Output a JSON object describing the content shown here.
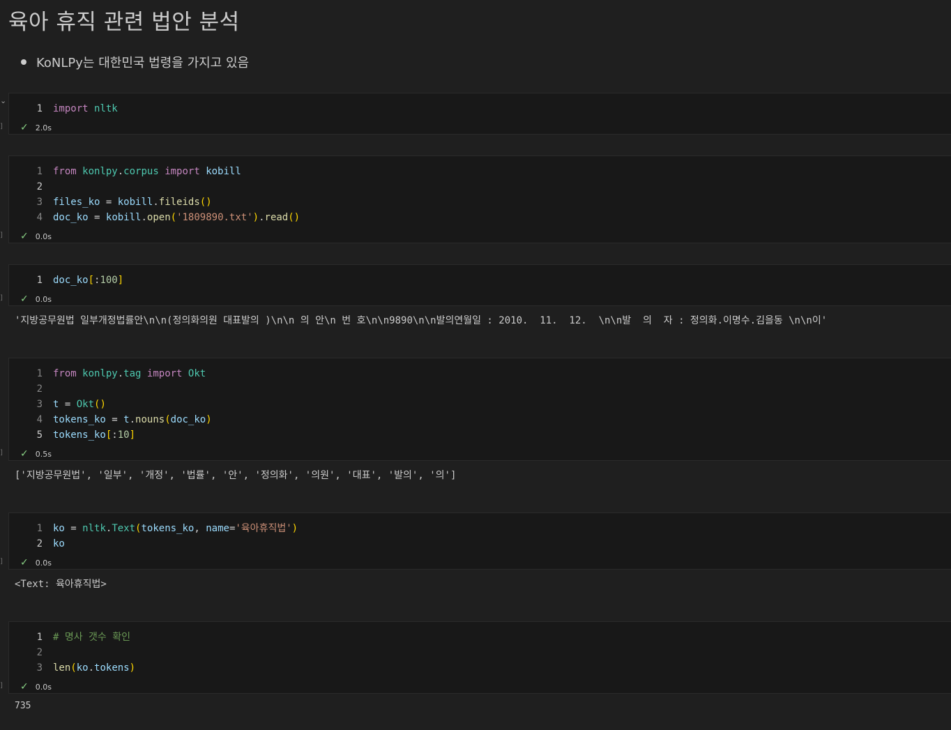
{
  "markdown": {
    "title": "육아 휴직 관련 법안 분석",
    "bullets": [
      "KoNLPy는 대한민국 법령을 가지고 있음"
    ]
  },
  "cells": [
    {
      "exec_time": "2.0s",
      "lines": [
        "import nltk"
      ]
    },
    {
      "exec_time": "0.0s",
      "lines": [
        "from konlpy.corpus import kobill",
        "",
        "files_ko = kobill.fileids()",
        "doc_ko = kobill.open('1809890.txt').read()"
      ]
    },
    {
      "exec_time": "0.0s",
      "lines": [
        "doc_ko[:100]"
      ],
      "output": "'지방공무원법 일부개정법률안\\n\\n(정의화의원 대표발의 )\\n\\n 의 안\\n 번 호\\n\\n9890\\n\\n발의연월일 : 2010.  11.  12.  \\n\\n발  의  자 : 정의화.이명수.김을동 \\n\\n이'"
    },
    {
      "exec_time": "0.5s",
      "lines": [
        "from konlpy.tag import Okt",
        "",
        "t = Okt()",
        "tokens_ko = t.nouns(doc_ko)",
        "tokens_ko[:10]"
      ],
      "output": "['지방공무원법', '일부', '개정', '법률', '안', '정의화', '의원', '대표', '발의', '의']"
    },
    {
      "exec_time": "0.0s",
      "lines": [
        "ko = nltk.Text(tokens_ko, name='육아휴직법')",
        "ko"
      ],
      "output": "<Text: 육아휴직법>"
    },
    {
      "exec_time": "0.0s",
      "lines": [
        "# 명사 갯수 확인",
        "",
        "len(ko.tokens)"
      ],
      "output": "735"
    }
  ],
  "icons": {
    "check": "check-icon",
    "collapse": "chevron-down-icon"
  }
}
